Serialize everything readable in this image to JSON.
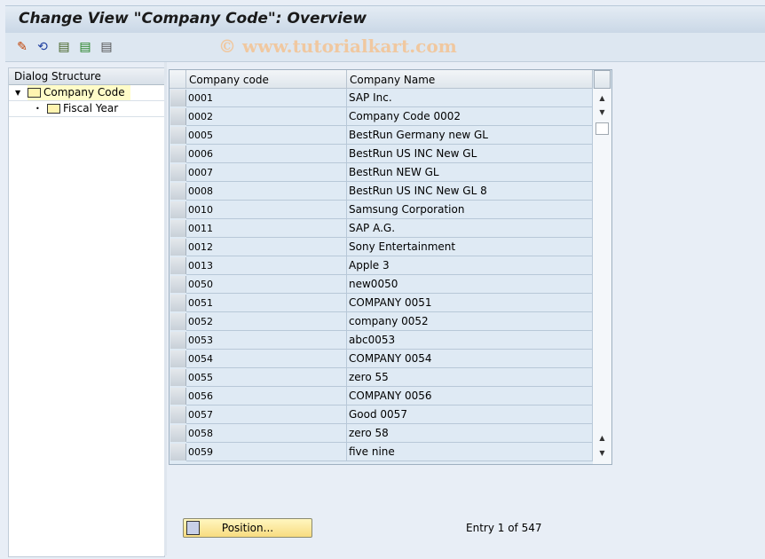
{
  "title": "Change View \"Company Code\": Overview",
  "watermark": "© www.tutorialkart.com",
  "toolbar": {
    "icons": [
      "display-change-icon",
      "undo-icon",
      "select-all-icon",
      "select-block-icon",
      "deselect-all-icon"
    ]
  },
  "dialog": {
    "header": "Dialog Structure",
    "nodes": [
      {
        "label": "Company Code",
        "selected": true
      },
      {
        "label": "Fiscal Year"
      }
    ]
  },
  "table": {
    "columns": [
      "Company code",
      "Company Name"
    ],
    "rows": [
      [
        "0001",
        "SAP Inc."
      ],
      [
        "0002",
        "Company Code 0002"
      ],
      [
        "0005",
        "BestRun Germany new GL"
      ],
      [
        "0006",
        "BestRun US INC New GL"
      ],
      [
        "0007",
        "BestRun NEW GL"
      ],
      [
        "0008",
        "BestRun US INC New GL 8"
      ],
      [
        "0010",
        "Samsung Corporation"
      ],
      [
        "0011",
        "SAP A.G."
      ],
      [
        "0012",
        "Sony Entertainment"
      ],
      [
        "0013",
        "Apple 3"
      ],
      [
        "0050",
        "new0050"
      ],
      [
        "0051",
        "COMPANY 0051"
      ],
      [
        "0052",
        "company 0052"
      ],
      [
        "0053",
        "abc0053"
      ],
      [
        "0054",
        "COMPANY 0054"
      ],
      [
        "0055",
        "zero 55"
      ],
      [
        "0056",
        "COMPANY 0056"
      ],
      [
        "0057",
        "Good 0057"
      ],
      [
        "0058",
        "zero 58"
      ],
      [
        "0059",
        "five nine"
      ]
    ]
  },
  "footer": {
    "position_label": "Position...",
    "entry_text": "Entry 1 of 547"
  }
}
